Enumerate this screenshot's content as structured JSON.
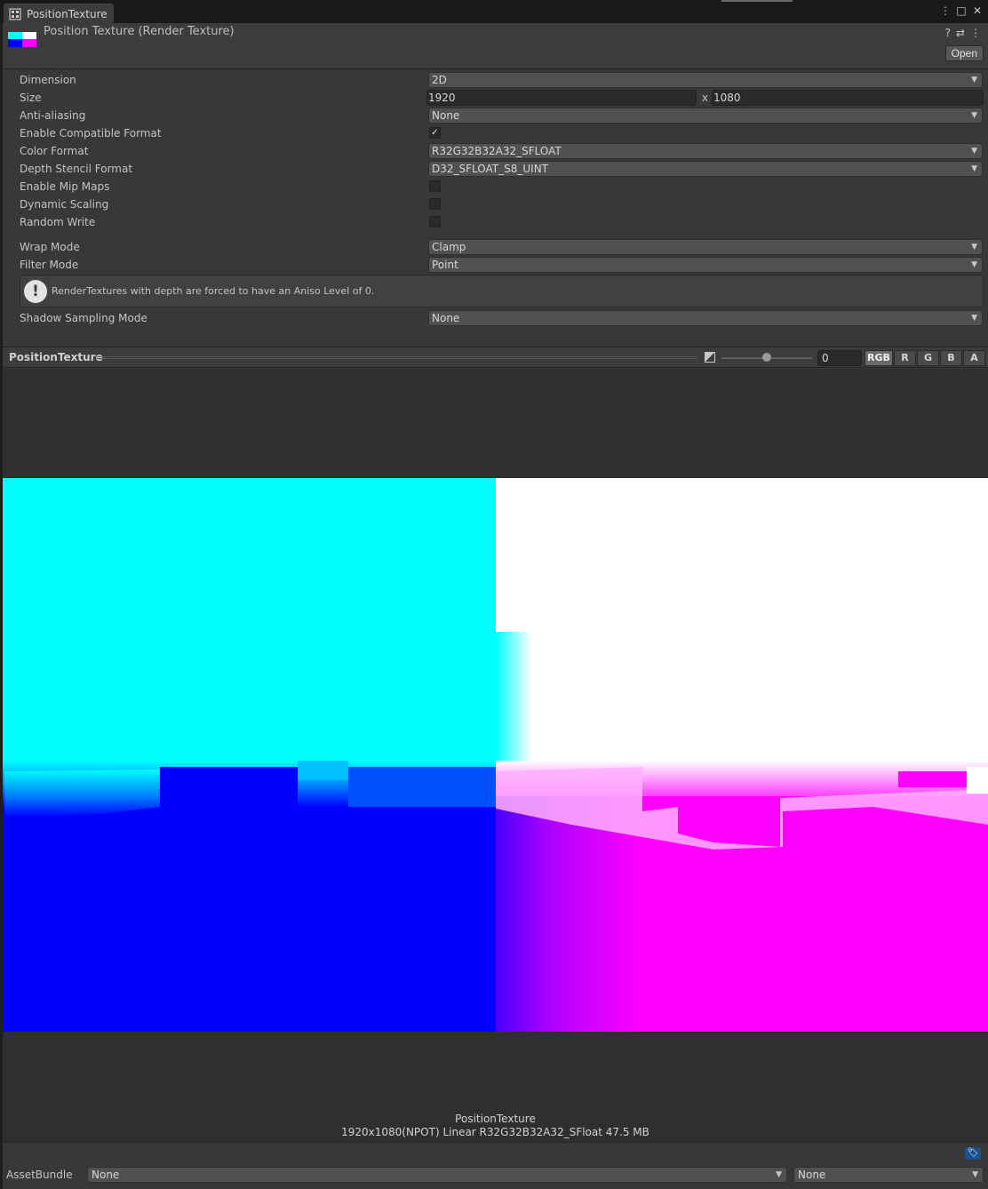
{
  "window": {
    "tab_title": "PositionTexture",
    "controls": [
      "⋮",
      "□",
      "✕"
    ]
  },
  "header": {
    "title": "Position Texture (Render Texture)",
    "icons": [
      "?",
      "⇄",
      "⋮"
    ],
    "open_label": "Open"
  },
  "properties": {
    "dimension": {
      "label": "Dimension",
      "value": "2D"
    },
    "size": {
      "label": "Size",
      "width": "1920",
      "separator": "x",
      "height": "1080"
    },
    "anti_aliasing": {
      "label": "Anti-aliasing",
      "value": "None"
    },
    "enable_compatible_format": {
      "label": "Enable Compatible Format",
      "checked": "✓"
    },
    "color_format": {
      "label": "Color Format",
      "value": "R32G32B32A32_SFLOAT"
    },
    "depth_stencil_format": {
      "label": "Depth Stencil Format",
      "value": "D32_SFLOAT_S8_UINT"
    },
    "enable_mip_maps": {
      "label": "Enable Mip Maps"
    },
    "dynamic_scaling": {
      "label": "Dynamic Scaling"
    },
    "random_write": {
      "label": "Random Write"
    },
    "wrap_mode": {
      "label": "Wrap Mode",
      "value": "Clamp"
    },
    "filter_mode": {
      "label": "Filter Mode",
      "value": "Point"
    },
    "help_message": "RenderTextures with depth are forced to have an Aniso Level of 0.",
    "shadow_sampling_mode": {
      "label": "Shadow Sampling Mode",
      "value": "None"
    }
  },
  "preview": {
    "name": "PositionTexture",
    "mip_level": "0",
    "channels": [
      "RGB",
      "R",
      "G",
      "B",
      "A"
    ],
    "caption_name": "PositionTexture",
    "caption_info": "1920x1080(NPOT) Linear  R32G32B32A32_SFloat  47.5 MB"
  },
  "footer": {
    "assetbundle_label": "AssetBundle",
    "bundle_name": "None",
    "bundle_variant": "None"
  },
  "colors": {
    "cyan": "#00ffff",
    "white": "#ffffff",
    "blue": "#0000ff",
    "magenta": "#ff00ff"
  }
}
